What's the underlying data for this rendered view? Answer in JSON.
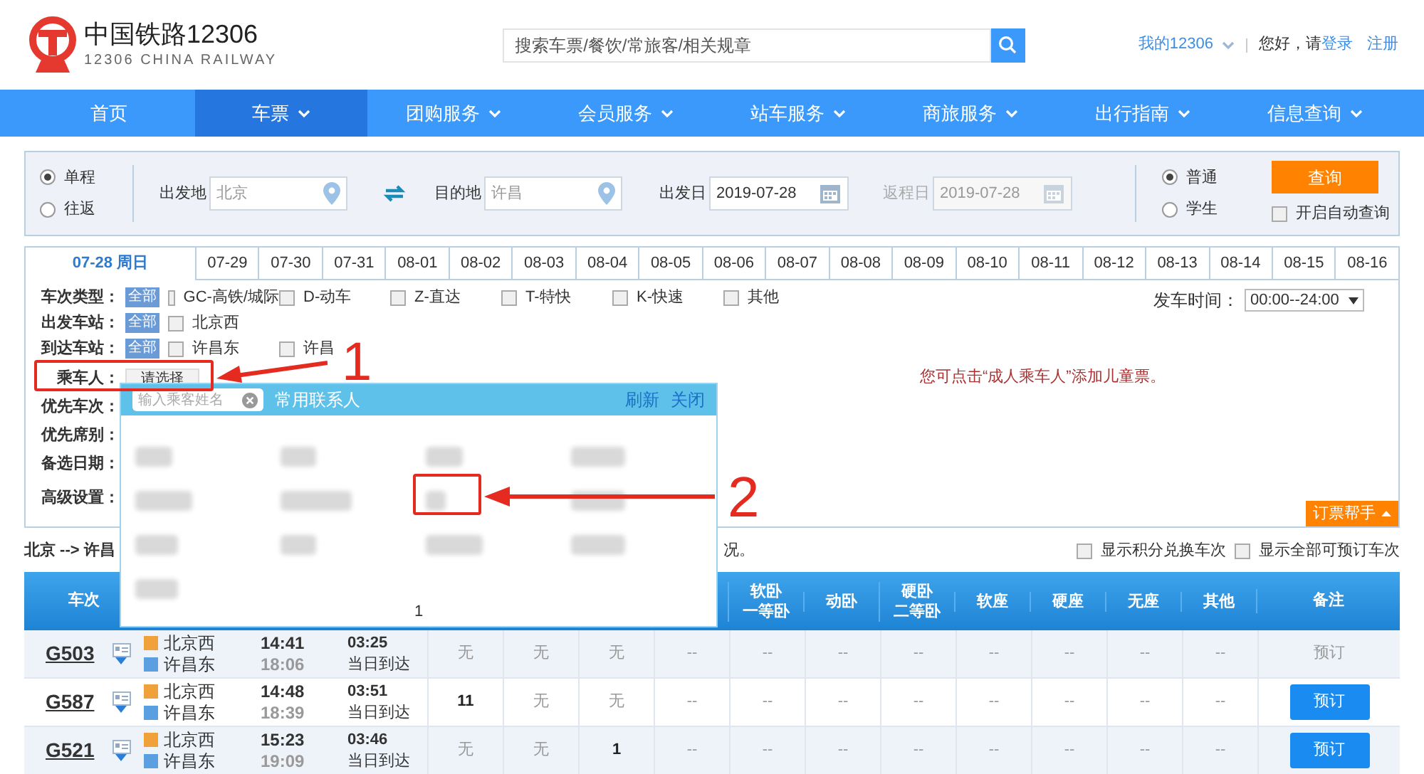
{
  "header": {
    "logo_title": "中国铁路12306",
    "logo_subtitle": "12306 CHINA RAILWAY",
    "search": {
      "placeholder": "搜索车票/餐饮/常旅客/相关规章"
    },
    "account": "我的12306",
    "greeting": "您好，请",
    "login": "登录",
    "register": "注册"
  },
  "nav": [
    {
      "label": "首页",
      "selected": false,
      "dropdown": false
    },
    {
      "label": "车票",
      "selected": true,
      "dropdown": true
    },
    {
      "label": "团购服务",
      "selected": false,
      "dropdown": true
    },
    {
      "label": "会员服务",
      "selected": false,
      "dropdown": true
    },
    {
      "label": "站车服务",
      "selected": false,
      "dropdown": true
    },
    {
      "label": "商旅服务",
      "selected": false,
      "dropdown": true
    },
    {
      "label": "出行指南",
      "selected": false,
      "dropdown": true
    },
    {
      "label": "信息查询",
      "selected": false,
      "dropdown": true
    }
  ],
  "query": {
    "trip_types": [
      {
        "label": "单程",
        "selected": true
      },
      {
        "label": "往返",
        "selected": false
      }
    ],
    "from": {
      "label": "出发地",
      "value": "北京"
    },
    "to": {
      "label": "目的地",
      "value": "许昌"
    },
    "depart_date": {
      "label": "出发日",
      "value": "2019-07-28",
      "disabled": false
    },
    "return_date": {
      "label": "返程日",
      "value": "2019-07-28",
      "disabled": true
    },
    "passenger_types": [
      {
        "label": "普通",
        "selected": true
      },
      {
        "label": "学生",
        "selected": false
      }
    ],
    "search_button": "查询",
    "auto_query": {
      "label": "开启自动查询",
      "checked": false
    }
  },
  "date_tabs": [
    {
      "label": "07-28 周日",
      "selected": true
    },
    {
      "label": "07-29",
      "selected": false
    },
    {
      "label": "07-30",
      "selected": false
    },
    {
      "label": "07-31",
      "selected": false
    },
    {
      "label": "08-01",
      "selected": false
    },
    {
      "label": "08-02",
      "selected": false
    },
    {
      "label": "08-03",
      "selected": false
    },
    {
      "label": "08-04",
      "selected": false
    },
    {
      "label": "08-05",
      "selected": false
    },
    {
      "label": "08-06",
      "selected": false
    },
    {
      "label": "08-07",
      "selected": false
    },
    {
      "label": "08-08",
      "selected": false
    },
    {
      "label": "08-09",
      "selected": false
    },
    {
      "label": "08-10",
      "selected": false
    },
    {
      "label": "08-11",
      "selected": false
    },
    {
      "label": "08-12",
      "selected": false
    },
    {
      "label": "08-13",
      "selected": false
    },
    {
      "label": "08-14",
      "selected": false
    },
    {
      "label": "08-15",
      "selected": false
    },
    {
      "label": "08-16",
      "selected": false
    }
  ],
  "filters": {
    "train_types": {
      "label": "车次类型：",
      "all": "全部",
      "options": [
        {
          "label": "GC-高铁/城际",
          "checked": false
        },
        {
          "label": "D-动车",
          "checked": false
        },
        {
          "label": "Z-直达",
          "checked": false
        },
        {
          "label": "T-特快",
          "checked": false
        },
        {
          "label": "K-快速",
          "checked": false
        },
        {
          "label": "其他",
          "checked": false
        }
      ]
    },
    "from_stations": {
      "label": "出发车站：",
      "all": "全部",
      "options": [
        {
          "label": "北京西",
          "checked": false
        }
      ]
    },
    "to_stations": {
      "label": "到达车站：",
      "all": "全部",
      "options": [
        {
          "label": "许昌东",
          "checked": false
        },
        {
          "label": "许昌",
          "checked": false
        }
      ]
    },
    "depart_time": {
      "label": "发车时间：",
      "value": "00:00--24:00"
    },
    "passenger": {
      "label": "乘车人：",
      "button": "请选择"
    },
    "rows": [
      {
        "label": "优先车次："
      },
      {
        "label": "优先席别："
      },
      {
        "label": "备选日期："
      },
      {
        "label": "高级设置："
      }
    ],
    "notice": "您可点击“成人乘车人”添加儿童票。",
    "helper": "订票帮手"
  },
  "route": {
    "text": "北京 --> 许昌",
    "tail": "况。"
  },
  "display_options": [
    {
      "label": "显示积分兑换车次",
      "checked": false
    },
    {
      "label": "显示全部可预订车次",
      "checked": false
    }
  ],
  "table": {
    "first_column": "车次",
    "columns": [
      {
        "lines": [
          "软卧",
          "一等卧"
        ]
      },
      {
        "lines": [
          "动卧"
        ]
      },
      {
        "lines": [
          "硬卧",
          "二等卧"
        ]
      },
      {
        "lines": [
          "软座"
        ]
      },
      {
        "lines": [
          "硬座"
        ]
      },
      {
        "lines": [
          "无座"
        ]
      },
      {
        "lines": [
          "其他"
        ]
      }
    ],
    "remarks_column": "备注",
    "rows": [
      {
        "train": "G503",
        "from": "北京西",
        "to": "许昌东",
        "depart": "14:41",
        "arrive": "18:06",
        "duration": "03:25",
        "arrival_day": "当日到达",
        "seats": [
          "无",
          "无",
          "无",
          "--",
          "--",
          "--",
          "--",
          "--",
          "--",
          "--",
          "--"
        ],
        "book": {
          "label": "预订",
          "available": false
        }
      },
      {
        "train": "G587",
        "from": "北京西",
        "to": "许昌东",
        "depart": "14:48",
        "arrive": "18:39",
        "duration": "03:51",
        "arrival_day": "当日到达",
        "seats": [
          "11",
          "无",
          "无",
          "--",
          "--",
          "--",
          "--",
          "--",
          "--",
          "--",
          "--"
        ],
        "book": {
          "label": "预订",
          "available": true
        }
      },
      {
        "train": "G521",
        "from": "北京西",
        "to": "许昌东",
        "depart": "15:23",
        "arrive": "19:09",
        "duration": "03:46",
        "arrival_day": "当日到达",
        "seats": [
          "无",
          "无",
          "1",
          "--",
          "--",
          "--",
          "--",
          "--",
          "--",
          "--",
          "--"
        ],
        "book": {
          "label": "预订",
          "available": true
        }
      }
    ]
  },
  "popup": {
    "search": {
      "placeholder": "输入乘客姓名"
    },
    "title": "常用联系人",
    "refresh": "刷新",
    "close": "关闭",
    "page": "1"
  },
  "annotations": [
    {
      "label": "1"
    },
    {
      "label": "2"
    }
  ]
}
